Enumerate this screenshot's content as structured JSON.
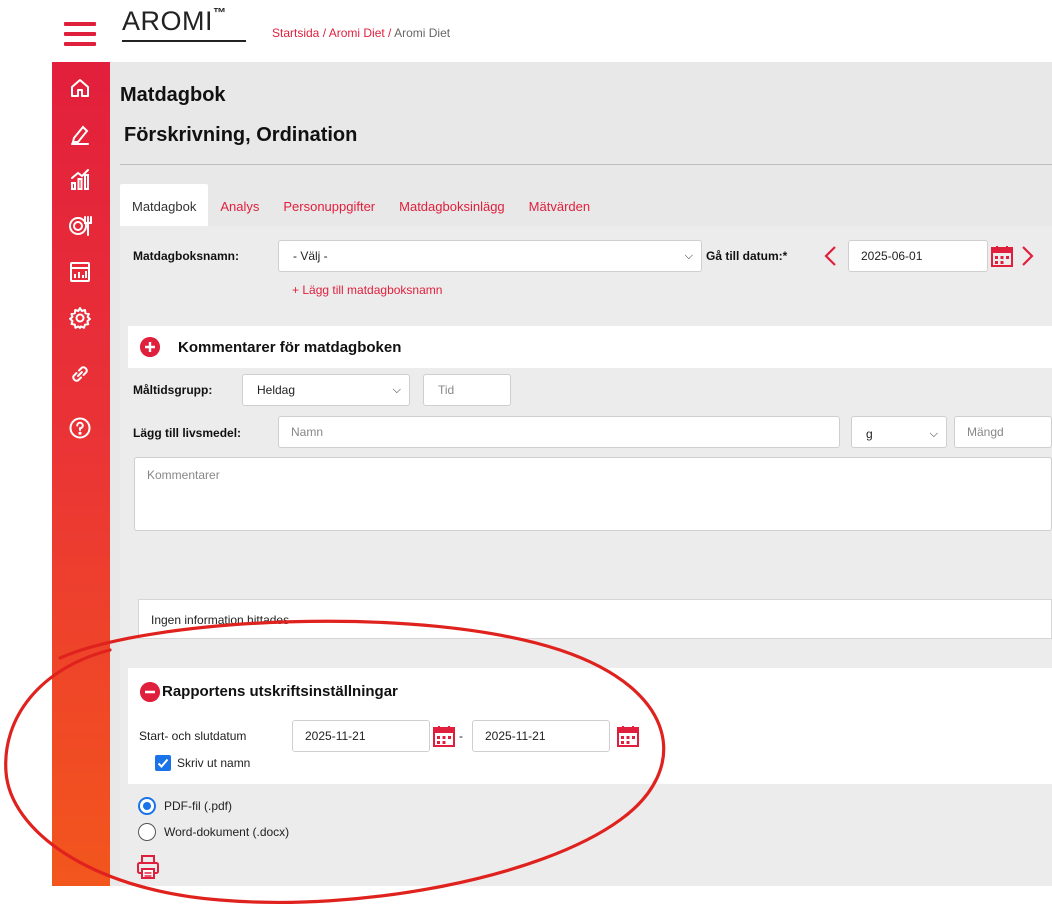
{
  "app": {
    "logo_text": "AROMI",
    "logo_mark": "™",
    "breadcrumb": {
      "home": "Startsida",
      "sep1": " / ",
      "section": "Aromi Diet",
      "sep2": " / ",
      "current": "Aromi Diet"
    }
  },
  "sidebar": {
    "items": [
      {
        "icon": "home-icon"
      },
      {
        "icon": "edit-icon"
      },
      {
        "icon": "chart-icon"
      },
      {
        "icon": "meal-icon"
      },
      {
        "icon": "report-icon"
      },
      {
        "icon": "gear-icon"
      },
      {
        "icon": "link-icon"
      },
      {
        "icon": "help-icon"
      }
    ]
  },
  "page": {
    "title": "Matdagbok",
    "subtitle": "Förskrivning, Ordination"
  },
  "tabs": [
    {
      "label": "Matdagbok",
      "active": true
    },
    {
      "label": "Analys"
    },
    {
      "label": "Personuppgifter"
    },
    {
      "label": "Matdagboksinlägg"
    },
    {
      "label": "Mätvärden"
    }
  ],
  "form": {
    "diary_name_label": "Matdagboksnamn:",
    "diary_name_value": "- Välj -",
    "add_diary_name": "+ Lägg till matdagboksnamn",
    "go_to_date_label": "Gå till datum:*",
    "go_to_date_value": "2025-06-01"
  },
  "comments_panel": {
    "title": "Kommentarer för matdagboken"
  },
  "meal": {
    "group_label": "Måltidsgrupp:",
    "group_value": "Heldag",
    "time_placeholder": "Tid",
    "add_food_label": "Lägg till livsmedel:",
    "name_placeholder": "Namn",
    "unit_value": "g",
    "amount_placeholder": "Mängd",
    "comments_placeholder": "Kommentarer"
  },
  "info": {
    "no_info": "Ingen information hittades"
  },
  "report": {
    "title": "Rapportens utskriftsinställningar",
    "date_range_label": "Start- och slutdatum",
    "start_date": "2025-11-21",
    "date_separator": "-",
    "end_date": "2025-11-21",
    "print_name_label": "Skriv ut namn",
    "print_name_checked": true
  },
  "output_format": {
    "options": [
      {
        "label": "PDF-fil (.pdf)",
        "selected": true
      },
      {
        "label": "Word-dokument (.docx)",
        "selected": false
      }
    ]
  },
  "colors": {
    "accent": "#e01f3d",
    "sidebar_bottom": "#f3561d",
    "checkbox": "#1a73e8",
    "annotation": "#e0221e"
  }
}
